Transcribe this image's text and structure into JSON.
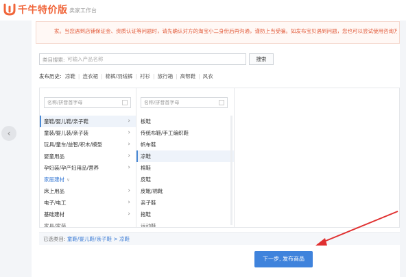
{
  "app": {
    "logo_text": "千牛特价版",
    "logo_sub": "卖家工作台",
    "logo_color": "#f0653a"
  },
  "notice": {
    "text": "家。当您遇到店铺保证金、资质认证等问题时，请先确认对方的淘宝小二身份后再沟通，谨防上当受骗。如发布宝贝遇到问题，您也可以尝试使用咨询万象客服来解"
  },
  "search": {
    "label": "类目搜索:",
    "placeholder": "可输入产品名称",
    "button_label": "搜索"
  },
  "history": {
    "label": "发布历史:",
    "items": [
      "凉鞋",
      "连衣裙",
      "棉裤/羽绒裤",
      "衬衫",
      "旅行箱",
      "高帮鞋",
      "风衣"
    ]
  },
  "columns": {
    "filter_placeholder": "名称/拼音首字母",
    "level1": {
      "items": [
        {
          "label": "童鞋/婴儿鞋/亲子鞋",
          "selected": true
        },
        {
          "label": "童装/婴儿装/亲子装"
        },
        {
          "label": "玩具/童车/益智/积木/模型"
        },
        {
          "label": "婴童用品"
        },
        {
          "label": "孕妇装/孕产妇用品/营养"
        }
      ],
      "group_label": "家居建材",
      "group_items": [
        {
          "label": "床上用品"
        },
        {
          "label": "电子/电工"
        },
        {
          "label": "基础建材"
        }
      ],
      "cut_item": "家具/家装"
    },
    "level2": {
      "items": [
        {
          "label": "板鞋"
        },
        {
          "label": "传统布鞋/手工编织鞋"
        },
        {
          "label": "帆布鞋"
        },
        {
          "label": "凉鞋",
          "selected": true
        },
        {
          "label": "棉鞋"
        },
        {
          "label": "皮鞋"
        },
        {
          "label": "皮靴/棉靴"
        },
        {
          "label": "亲子鞋"
        },
        {
          "label": "拖鞋"
        }
      ],
      "cut_item": "运动鞋"
    }
  },
  "selected": {
    "label": "已选类目:",
    "path": "童鞋/婴儿鞋/亲子鞋 > 凉鞋"
  },
  "next_button": {
    "label": "下一步, 发布商品",
    "color": "#3f83dc"
  },
  "annotation": {
    "arrow_color": "#e03030"
  }
}
